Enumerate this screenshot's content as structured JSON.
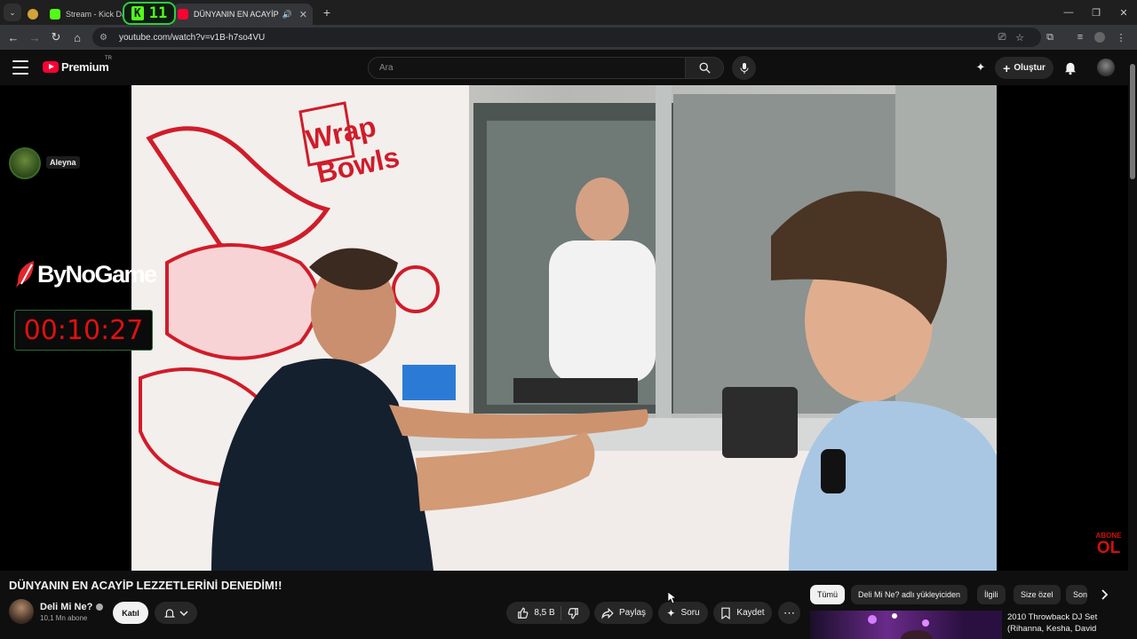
{
  "browser": {
    "tabs": [
      {
        "label": "Stream - Kick Da",
        "favicon_color": "#53fc18",
        "active": false
      },
      {
        "label": "DÜNYANIN EN ACAYİP LEZZ",
        "favicon_color": "#ff0033",
        "active": true
      }
    ],
    "kick_badge_count": "11",
    "url": "youtube.com/watch?v=v1B-h7so4VU",
    "new_tab": "+"
  },
  "header": {
    "logo_text": "Premium",
    "region": "TR",
    "search_placeholder": "Ara",
    "create_label": "Oluştur"
  },
  "overlay": {
    "viewer_name": "Aleyna",
    "brand": "ByNoGame",
    "timer": "00:10:27",
    "abone_top": "ABONE",
    "abone_bottom": "OL"
  },
  "video": {
    "sign_text_1": "Wrap",
    "sign_text_2": "Bowls",
    "title": "DÜNYANIN EN ACAYİP LEZZETLERİNİ DENEDİM!!"
  },
  "channel": {
    "name": "Deli Mi Ne?",
    "subscribers": "10,1 Mn abone",
    "join_label": "Katıl"
  },
  "actions": {
    "likes": "8,5 B",
    "share": "Paylaş",
    "ask": "Soru",
    "save": "Kaydet"
  },
  "chips": [
    "Tümü",
    "Deli Mi Ne? adlı yükleyiciden",
    "İlgili",
    "Size özel",
    "Son"
  ],
  "recommendation": {
    "title": "2010 Throwback DJ Set (Rihanna, Kesha, David"
  },
  "colors": {
    "accent": "#ff0033",
    "kick": "#53fc18",
    "timer": "#e01010"
  }
}
